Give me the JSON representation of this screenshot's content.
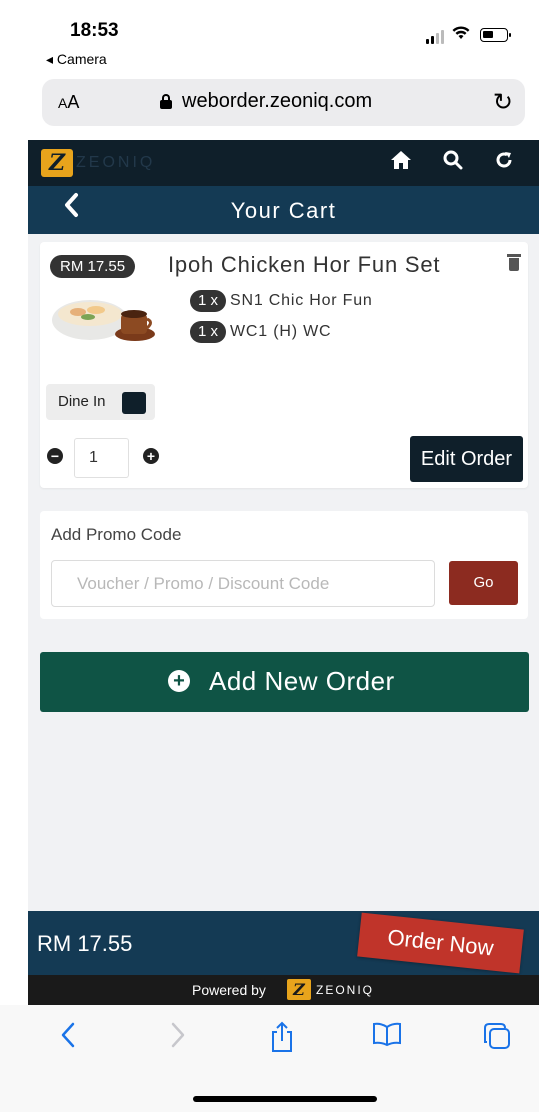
{
  "status_bar": {
    "time": "18:53",
    "back_app": "◂ Camera"
  },
  "address_bar": {
    "text_size_label": "AA",
    "url": "weborder.zeoniq.com"
  },
  "app_header": {
    "brand": "ZEONIQ"
  },
  "title_bar": {
    "title": "Your Cart"
  },
  "cart_item": {
    "price": "RM 17.55",
    "name": "Ipoh Chicken Hor Fun Set",
    "sub_items": [
      {
        "qty": "1 x",
        "name": "SN1 Chic Hor Fun"
      },
      {
        "qty": "1 x",
        "name": "WC1 (H) WC"
      }
    ],
    "dine_option": "Dine In",
    "quantity": "1",
    "edit_label": "Edit Order"
  },
  "promo": {
    "label": "Add Promo Code",
    "placeholder": "Voucher / Promo / Discount Code",
    "go_label": "Go"
  },
  "add_order": {
    "label": "Add New Order"
  },
  "footer": {
    "total": "RM 17.55",
    "order_now_label": "Order Now",
    "powered_by": "Powered by",
    "powered_brand": "ZEONIQ"
  },
  "colors": {
    "navbar": "#0f1f2a",
    "title_bar": "#143a54",
    "add_order": "#0f5445",
    "order_now": "#c0342a",
    "go_button": "#8c2b20",
    "brand_gold": "#e8a41c"
  }
}
